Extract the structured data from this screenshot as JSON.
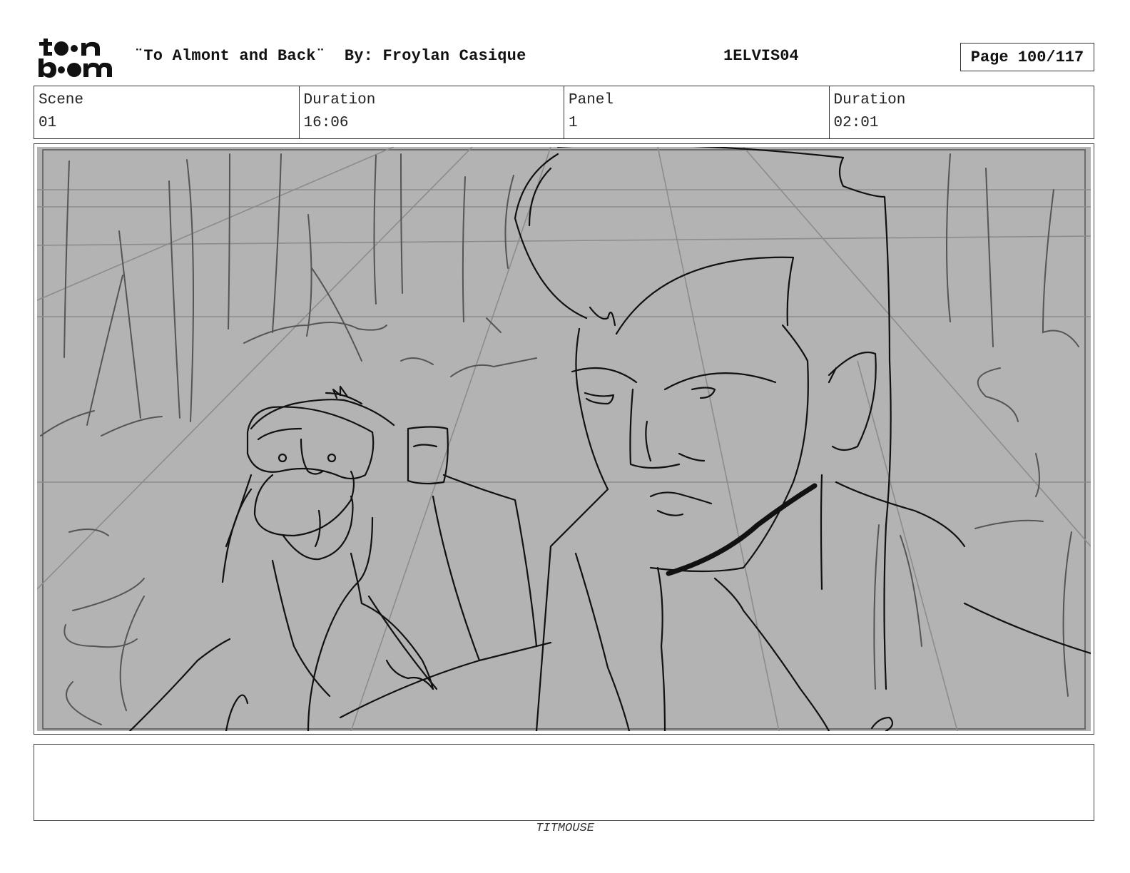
{
  "logo": {
    "name": "toon boom",
    "line1": "toon",
    "line2": "boom"
  },
  "header": {
    "title": "¨To Almont and Back¨  By: Froylan Casique",
    "code": "1ELVIS04",
    "page": "Page 100/117"
  },
  "info": {
    "scene_label": "Scene",
    "scene_value": "01",
    "scene_duration_label": "Duration",
    "scene_duration_value": "16:06",
    "panel_label": "Panel",
    "panel_value": "1",
    "panel_duration_label": "Duration",
    "panel_duration_value": "02:01"
  },
  "panel": {
    "image_subject": "rough sketch of a chimpanzee and a man with a pompadour in a forest",
    "background_color": "#b3b3b3",
    "line_color": "#111111"
  },
  "notes": {
    "text": ""
  },
  "footer": {
    "studio": "TITMOUSE"
  }
}
